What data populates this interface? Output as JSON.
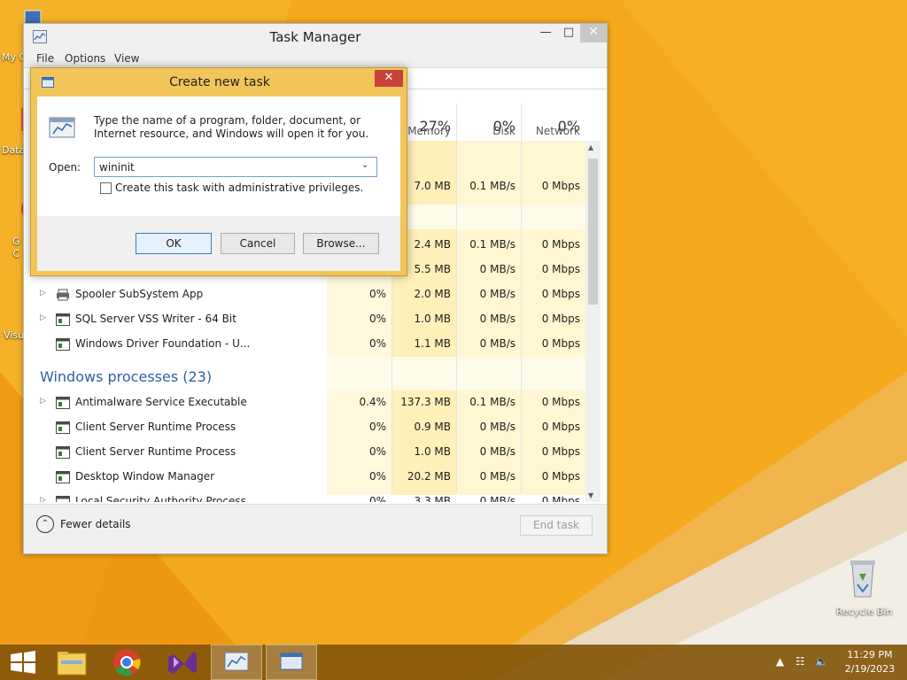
{
  "desktop": {
    "icons": [
      {
        "label": "My C"
      },
      {
        "label": "Data"
      },
      {
        "label": "G\nC"
      },
      {
        "label": "Visu"
      },
      {
        "label": "Recycle Bin"
      }
    ]
  },
  "task_manager": {
    "title": "Task Manager",
    "menu": [
      "File",
      "Options",
      "View"
    ],
    "columns": {
      "memory": {
        "percent": "27%",
        "label": "Memory"
      },
      "disk": {
        "percent": "0%",
        "label": "Disk"
      },
      "network": {
        "percent": "0%",
        "label": "Network"
      }
    },
    "rows_top": [
      {
        "memory": "7.0 MB",
        "disk": "0.1 MB/s",
        "network": "0 Mbps"
      },
      {
        "memory": "2.4 MB",
        "disk": "0.1 MB/s",
        "network": "0 Mbps"
      },
      {
        "memory": "5.5 MB",
        "disk": "0 MB/s",
        "network": "0 Mbps"
      }
    ],
    "background_rows": [
      {
        "name": "Spooler SubSystem App",
        "cpu": "0%",
        "memory": "2.0 MB",
        "disk": "0 MB/s",
        "network": "0 Mbps",
        "expandable": true,
        "icon": "printer-icon"
      },
      {
        "name": "SQL Server VSS Writer - 64 Bit",
        "cpu": "0%",
        "memory": "1.0 MB",
        "disk": "0 MB/s",
        "network": "0 Mbps",
        "expandable": true,
        "icon": "app-window-icon"
      },
      {
        "name": "Windows Driver Foundation - U...",
        "cpu": "0%",
        "memory": "1.1 MB",
        "disk": "0 MB/s",
        "network": "0 Mbps",
        "expandable": false,
        "icon": "app-window-icon"
      }
    ],
    "group_title": "Windows processes (23)",
    "windows_rows": [
      {
        "name": "Antimalware Service Executable",
        "cpu": "0.4%",
        "memory": "137.3 MB",
        "disk": "0.1 MB/s",
        "network": "0 Mbps",
        "expandable": true,
        "icon": "app-window-icon"
      },
      {
        "name": "Client Server Runtime Process",
        "cpu": "0%",
        "memory": "0.9 MB",
        "disk": "0 MB/s",
        "network": "0 Mbps",
        "expandable": false,
        "icon": "app-window-icon"
      },
      {
        "name": "Client Server Runtime Process",
        "cpu": "0%",
        "memory": "1.0 MB",
        "disk": "0 MB/s",
        "network": "0 Mbps",
        "expandable": false,
        "icon": "app-window-icon"
      },
      {
        "name": "Desktop Window Manager",
        "cpu": "0%",
        "memory": "20.2 MB",
        "disk": "0 MB/s",
        "network": "0 Mbps",
        "expandable": false,
        "icon": "app-window-icon"
      },
      {
        "name": "Local Security Authority Process",
        "cpu": "0%",
        "memory": "3.3 MB",
        "disk": "0 MB/s",
        "network": "0 Mbps",
        "expandable": true,
        "icon": "app-window-icon"
      }
    ],
    "footer": {
      "fewer_details": "Fewer details",
      "end_task": "End task"
    }
  },
  "dialog": {
    "title": "Create new task",
    "description": "Type the name of a program, folder, document, or Internet resource, and Windows will open it for you.",
    "open_label": "Open:",
    "open_value": "wininit",
    "checkbox_label": "Create this task with administrative privileges.",
    "checkbox_checked": false,
    "ok": "OK",
    "cancel": "Cancel",
    "browse": "Browse..."
  },
  "taskbar": {
    "time": "11:29 PM",
    "date": "2/19/2023",
    "items": [
      "start-button",
      "file-explorer",
      "chrome",
      "visual-studio",
      "task-manager",
      "run-dialog"
    ]
  },
  "colors": {
    "wallpaper": "#f3a81a",
    "dialog_frame": "#f2c55a",
    "heat_light": "#fff4cf",
    "heat_mid": "#ffeeb0",
    "group_title": "#2f5ea7",
    "close_button": "#c7423a"
  }
}
